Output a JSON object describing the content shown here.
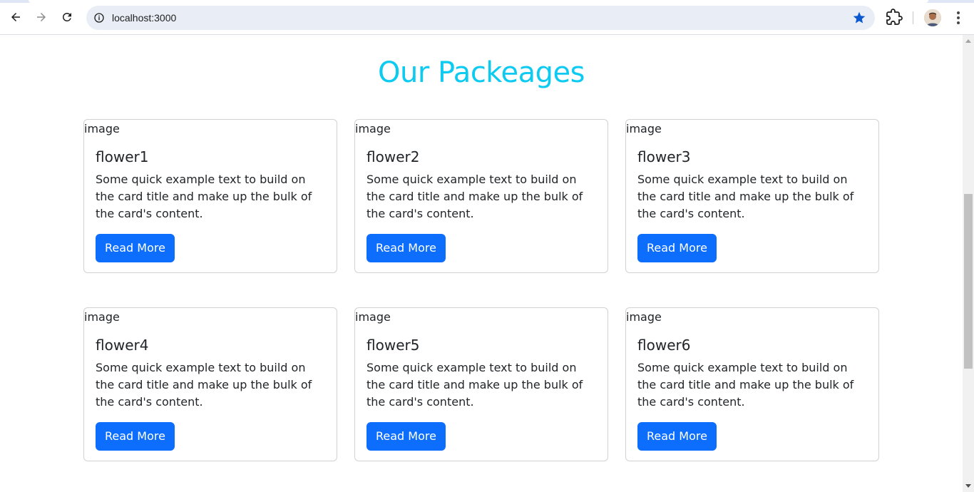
{
  "browser": {
    "url": "localhost:3000",
    "bookmark_color": "#0b57d0"
  },
  "page": {
    "title": "Our Packeages",
    "title_color": "#0dcaf0"
  },
  "cards": [
    {
      "image_alt": "image",
      "title": "flower1",
      "text": "Some quick example text to build on the card title and make up the bulk of the card's content.",
      "button": "Read More"
    },
    {
      "image_alt": "image",
      "title": "flower2",
      "text": "Some quick example text to build on the card title and make up the bulk of the card's content.",
      "button": "Read More"
    },
    {
      "image_alt": "image",
      "title": "flower3",
      "text": "Some quick example text to build on the card title and make up the bulk of the card's content.",
      "button": "Read More"
    },
    {
      "image_alt": "image",
      "title": "flower4",
      "text": "Some quick example text to build on the card title and make up the bulk of the card's content.",
      "button": "Read More"
    },
    {
      "image_alt": "image",
      "title": "flower5",
      "text": "Some quick example text to build on the card title and make up the bulk of the card's content.",
      "button": "Read More"
    },
    {
      "image_alt": "image",
      "title": "flower6",
      "text": "Some quick example text to build on the card title and make up the bulk of the card's content.",
      "button": "Read More"
    }
  ],
  "button_color": "#0d6efd"
}
